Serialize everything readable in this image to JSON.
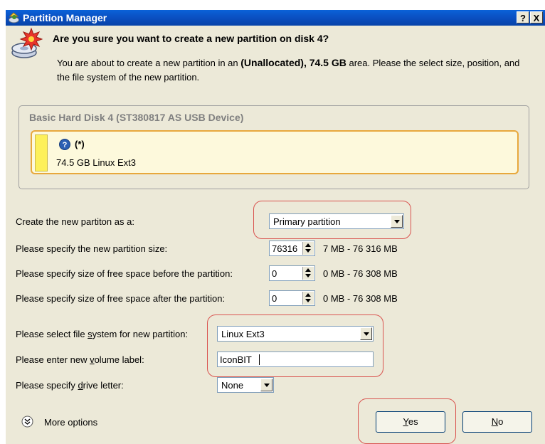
{
  "window": {
    "title": "Partition Manager",
    "help_label": "?",
    "close_label": "X"
  },
  "header": {
    "heading": "Are you sure you want to create a new partition on disk 4?",
    "desc_part1": "You are about to create a new partition in an ",
    "desc_area": "(Unallocated), 74.5 GB",
    "desc_part2": " area. Please the select size, position, and the file system of the new partition."
  },
  "disk": {
    "title": "Basic Hard Disk 4 (ST380817 AS USB Device)",
    "partition_name": "(*)",
    "partition_size": "74.5 GB Linux Ext3"
  },
  "form": {
    "create_as_label": "Create the new partiton as a:",
    "create_as_value": "Primary partition",
    "size_label": "Please specify the new partition size:",
    "size_value": "76316",
    "size_range": "7 MB - 76 316 MB",
    "before_label": "Please specify size of free space before the partition:",
    "before_value": "0",
    "before_range": "0 MB - 76 308 MB",
    "after_label": "Please specify size of free space after the partition:",
    "after_value": "0",
    "after_range": "0 MB - 76 308 MB",
    "fs_label_pre": "Please select file ",
    "fs_label_key": "s",
    "fs_label_post": "ystem for new partition:",
    "fs_value": "Linux Ext3",
    "vol_label_pre": "Please enter new ",
    "vol_label_key": "v",
    "vol_label_post": "olume label:",
    "vol_value": "IconBIT",
    "drive_label_pre": "Please specify ",
    "drive_label_key": "d",
    "drive_label_post": "rive letter:",
    "drive_value": "None"
  },
  "footer": {
    "more_options": "More options",
    "yes_key": "Y",
    "yes_rest": "es",
    "no_key": "N",
    "no_rest": "o"
  },
  "colors": {
    "titlebar": "#0a4fc1",
    "dialog_bg": "#ece9d8",
    "highlight": "#d9534f",
    "partition_border": "#e8a83c",
    "partition_fill": "#fdf05a"
  }
}
